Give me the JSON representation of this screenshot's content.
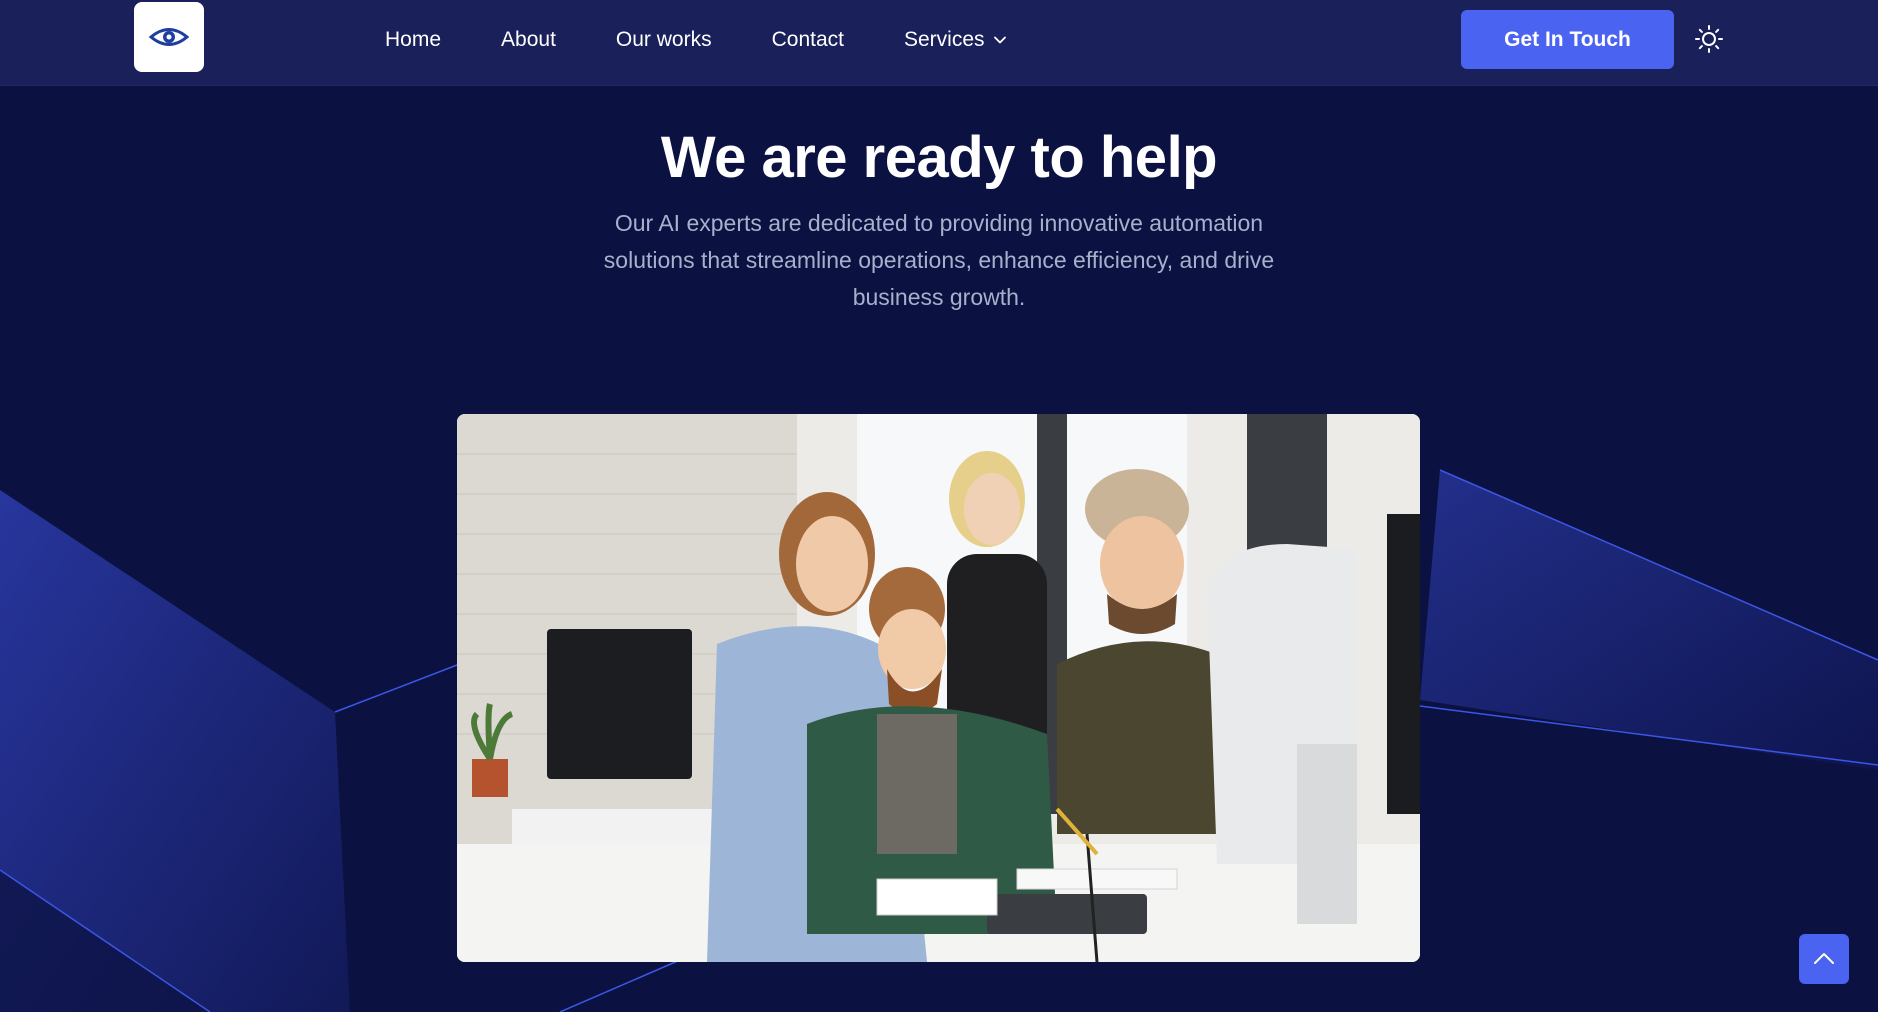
{
  "header": {
    "logo_alt": "Company logo",
    "nav": [
      {
        "label": "Home"
      },
      {
        "label": "About"
      },
      {
        "label": "Our works"
      },
      {
        "label": "Contact"
      },
      {
        "label": "Services"
      }
    ],
    "cta_label": "Get In Touch",
    "theme_icon": "sun-icon"
  },
  "hero": {
    "title": "We are ready to help",
    "subtitle": "Our AI experts are dedicated to providing innovative automation solutions that streamline operations, enhance efficiency, and drive business growth.",
    "image_description": "team-at-computer-photo"
  },
  "scroll_top_icon": "chevron-up-icon",
  "colors": {
    "background": "#0b1140",
    "header": "#19205a",
    "accent": "#4a63f0",
    "subtitle": "#a9b0cc"
  }
}
